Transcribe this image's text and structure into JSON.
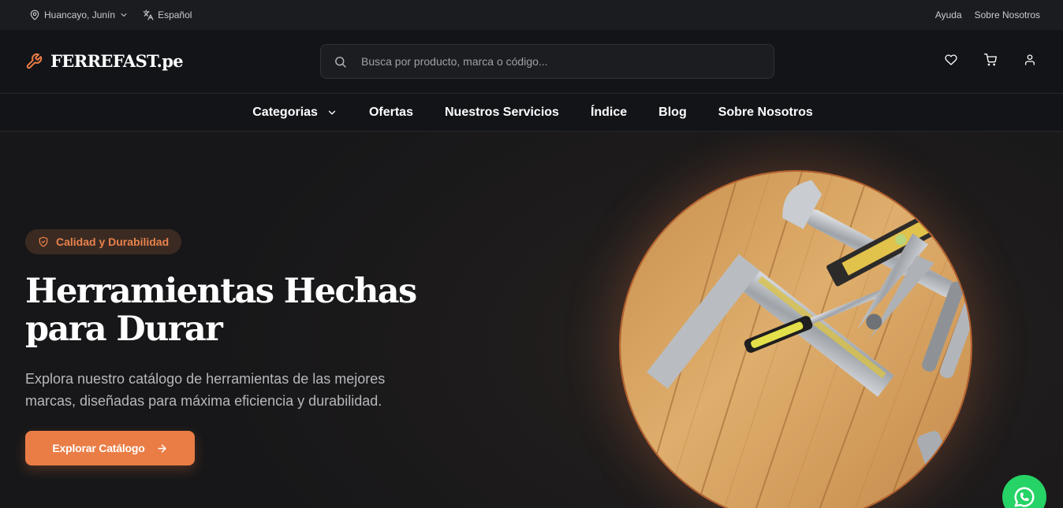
{
  "topbar": {
    "location": "Huancayo, Junín",
    "language": "Español",
    "help": "Ayuda",
    "about": "Sobre Nosotros"
  },
  "header": {
    "logo": "FERREFAST.pe",
    "search_placeholder": "Busca por producto, marca o código...",
    "icons": [
      "heart-icon",
      "cart-icon",
      "user-icon"
    ]
  },
  "nav": {
    "items": [
      "Categorias",
      "Ofertas",
      "Nuestros Servicios",
      "Índice",
      "Blog",
      "Sobre Nosotros"
    ]
  },
  "hero": {
    "badge": "Calidad y Durabilidad",
    "title": "Herramientas Hechas para Durar",
    "subtitle": "Explora nuestro catálogo de herramientas de las mejores marcas, diseñadas para máxima eficiencia y durabilidad.",
    "cta": "Explorar Catálogo"
  },
  "colors": {
    "accent": "#ea7d45",
    "background": "#1c1a1b",
    "whatsapp": "#25d366"
  }
}
